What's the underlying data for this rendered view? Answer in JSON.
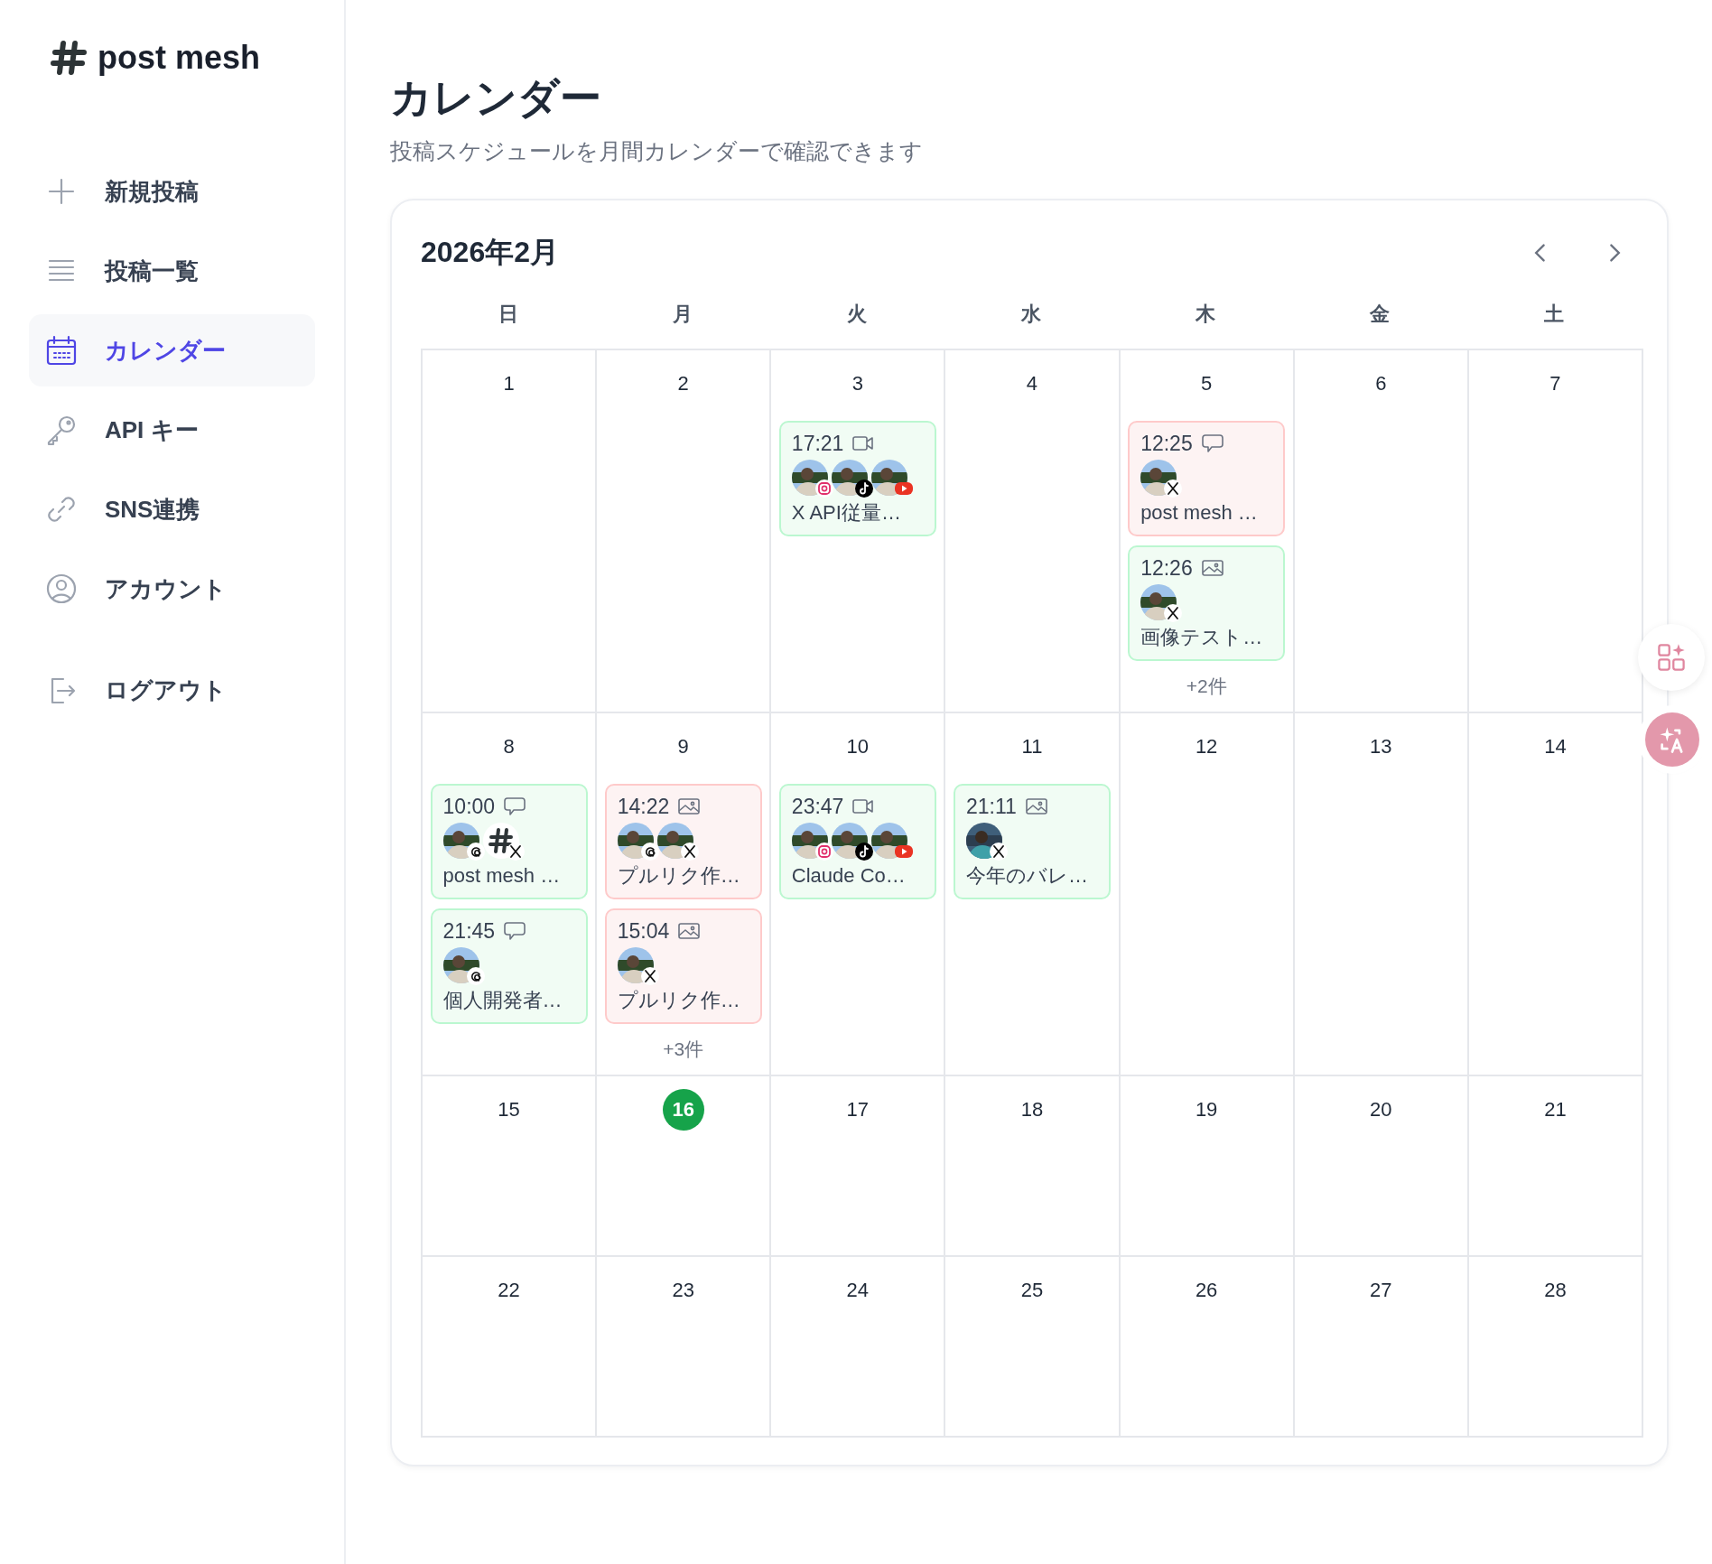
{
  "brand": {
    "name": "post mesh"
  },
  "nav": [
    {
      "label": "新規投稿",
      "kind": "plus",
      "selected": false
    },
    {
      "label": "投稿一覧",
      "kind": "list",
      "selected": false
    },
    {
      "label": "カレンダー",
      "kind": "calendar",
      "selected": true
    },
    {
      "label": "API キー",
      "kind": "key",
      "selected": false
    },
    {
      "label": "SNS連携",
      "kind": "link",
      "selected": false
    },
    {
      "label": "アカウント",
      "kind": "user",
      "selected": false
    }
  ],
  "footer_nav": [
    {
      "label": "ログアウト",
      "kind": "logout",
      "selected": false
    }
  ],
  "page": {
    "title": "カレンダー",
    "subtitle": "投稿スケジュールを月間カレンダーで確認できます"
  },
  "calendar": {
    "month": "2026年2月",
    "weekdays": [
      "日",
      "月",
      "火",
      "水",
      "木",
      "金",
      "土"
    ],
    "days": [
      {
        "day": "1",
        "today": false
      },
      {
        "day": "2",
        "today": false
      },
      {
        "day": "3",
        "today": false,
        "events": [
          {
            "time": "17:21",
            "kind": "video",
            "color": "#bbf7d0",
            "title": "X API従量…",
            "accounts": [
              {
                "kind": "instagram",
                "avatar": {
                  "kind": "photo"
                }
              },
              {
                "kind": "tiktok",
                "avatar": {
                  "kind": "photo"
                }
              },
              {
                "kind": "youtube",
                "avatar": {
                  "kind": "photo"
                }
              }
            ]
          }
        ]
      },
      {
        "day": "4",
        "today": false
      },
      {
        "day": "5",
        "today": false,
        "events": [
          {
            "time": "12:25",
            "kind": "text",
            "color": "#fecaca",
            "title": "post mesh …",
            "accounts": [
              {
                "kind": "x",
                "avatar": {
                  "kind": "photo"
                }
              }
            ]
          },
          {
            "time": "12:26",
            "kind": "image",
            "color": "#bbf7d0",
            "title": "画像テスト…",
            "accounts": [
              {
                "kind": "x",
                "avatar": {
                  "kind": "photo"
                }
              }
            ]
          }
        ],
        "more": "+2件"
      },
      {
        "day": "6",
        "today": false
      },
      {
        "day": "7",
        "today": false
      },
      {
        "day": "8",
        "today": false,
        "events": [
          {
            "time": "10:00",
            "kind": "text",
            "color": "#bbf7d0",
            "title": "post mesh …",
            "accounts": [
              {
                "kind": "threads",
                "avatar": {
                  "kind": "photo"
                }
              },
              {
                "kind": "x",
                "avatar": {
                  "kind": "logo"
                }
              }
            ]
          },
          {
            "time": "21:45",
            "kind": "text",
            "color": "#bbf7d0",
            "title": "個人開発者…",
            "accounts": [
              {
                "kind": "threads",
                "avatar": {
                  "kind": "photo"
                }
              }
            ]
          }
        ]
      },
      {
        "day": "9",
        "today": false,
        "events": [
          {
            "time": "14:22",
            "kind": "image",
            "color": "#fecaca",
            "title": "プルリク作…",
            "accounts": [
              {
                "kind": "threads",
                "avatar": {
                  "kind": "photo"
                }
              },
              {
                "kind": "x",
                "avatar": {
                  "kind": "photo"
                }
              }
            ]
          },
          {
            "time": "15:04",
            "kind": "image",
            "color": "#fecaca",
            "title": "プルリク作…",
            "accounts": [
              {
                "kind": "x",
                "avatar": {
                  "kind": "photo"
                }
              }
            ]
          }
        ],
        "more": "+3件"
      },
      {
        "day": "10",
        "today": false,
        "events": [
          {
            "time": "23:47",
            "kind": "video",
            "color": "#bbf7d0",
            "title": "Claude Co…",
            "accounts": [
              {
                "kind": "instagram",
                "avatar": {
                  "kind": "photo"
                }
              },
              {
                "kind": "tiktok",
                "avatar": {
                  "kind": "photo"
                }
              },
              {
                "kind": "youtube",
                "avatar": {
                  "kind": "photo"
                }
              }
            ]
          }
        ]
      },
      {
        "day": "11",
        "today": false,
        "events": [
          {
            "time": "21:11",
            "kind": "image",
            "color": "#bbf7d0",
            "title": "今年のバレ…",
            "accounts": [
              {
                "kind": "x",
                "avatar": {
                  "kind": "portrait"
                }
              }
            ]
          }
        ]
      },
      {
        "day": "12",
        "today": false
      },
      {
        "day": "13",
        "today": false
      },
      {
        "day": "14",
        "today": false
      },
      {
        "day": "15",
        "today": false
      },
      {
        "day": "16",
        "today": true
      },
      {
        "day": "17",
        "today": false
      },
      {
        "day": "18",
        "today": false
      },
      {
        "day": "19",
        "today": false
      },
      {
        "day": "20",
        "today": false
      },
      {
        "day": "21",
        "today": false
      },
      {
        "day": "22",
        "today": false
      },
      {
        "day": "23",
        "today": false
      },
      {
        "day": "24",
        "today": false
      },
      {
        "day": "25",
        "today": false
      },
      {
        "day": "26",
        "today": false
      },
      {
        "day": "27",
        "today": false
      },
      {
        "day": "28",
        "today": false
      }
    ]
  }
}
